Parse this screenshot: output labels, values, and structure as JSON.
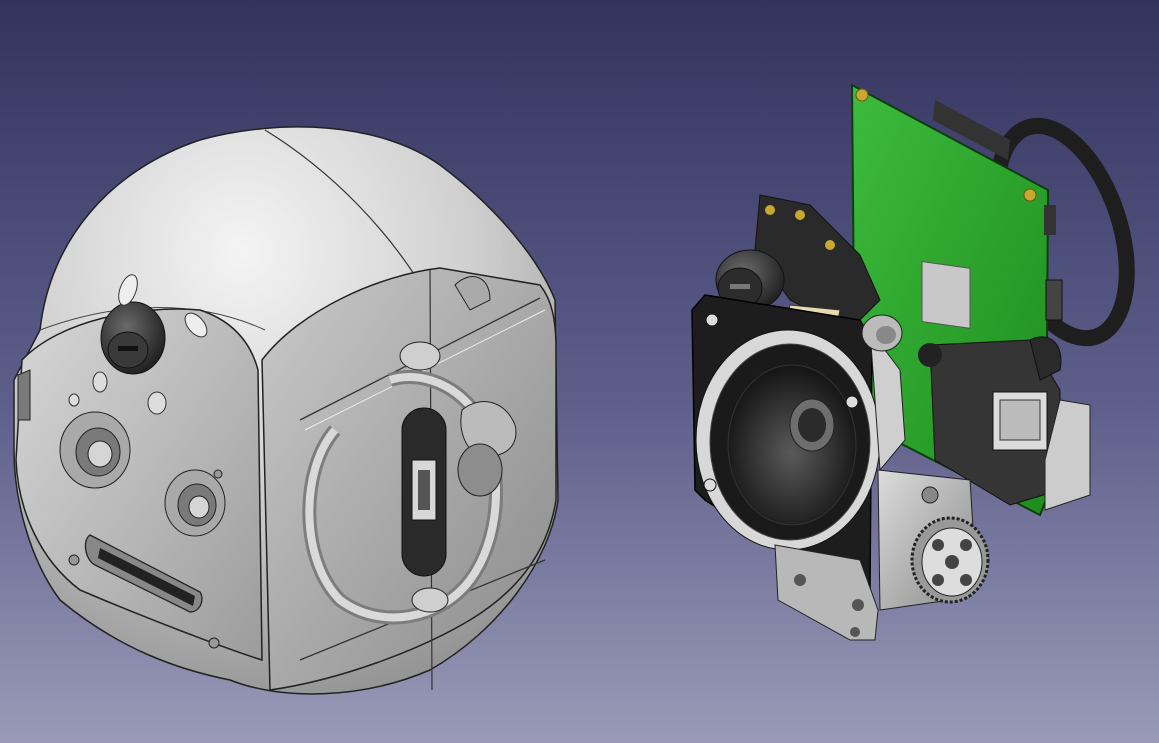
{
  "viewport": {
    "background_top": "#33335e",
    "background_bottom": "#9a9ab8"
  },
  "models": [
    {
      "name": "robot-head-shell",
      "color": "#c6c6c6"
    },
    {
      "name": "electronics-assembly",
      "pcb_color": "#2aa02a",
      "parts": [
        "camera-module",
        "speaker",
        "servo",
        "pcb",
        "ring"
      ]
    }
  ]
}
